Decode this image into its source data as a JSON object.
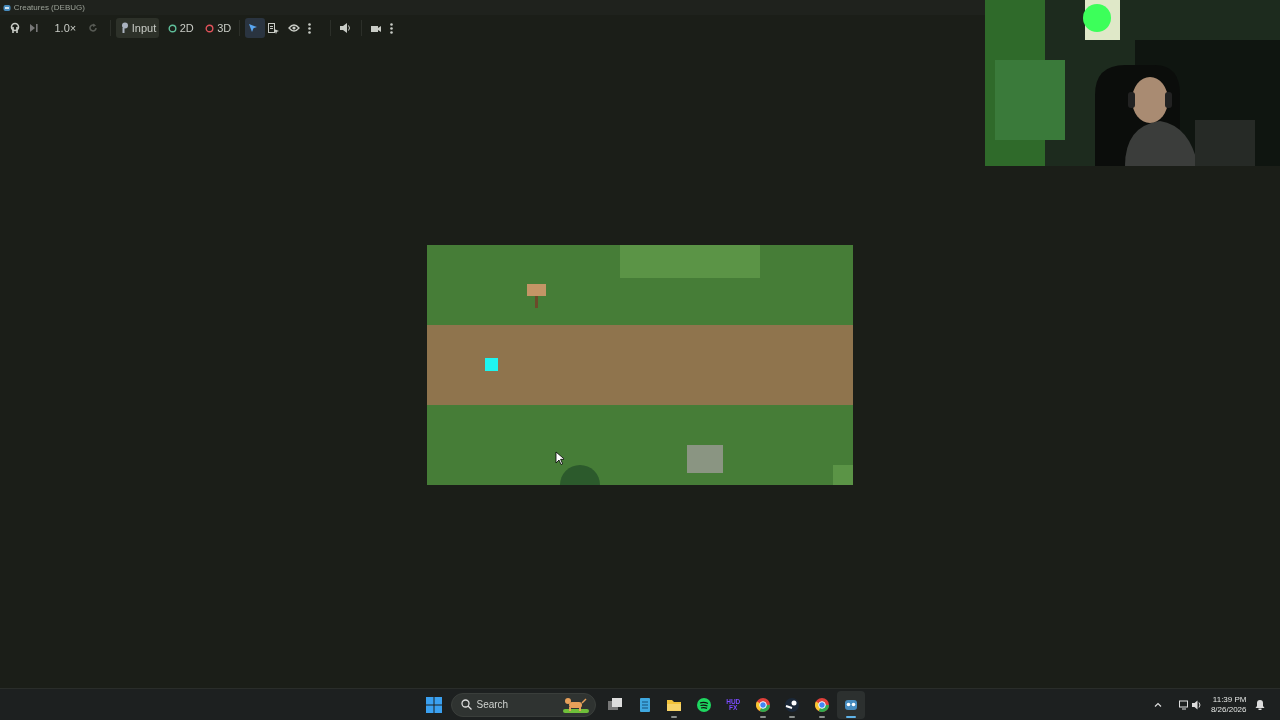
{
  "window": {
    "title": "Creatures (DEBUG)"
  },
  "toolbar": {
    "speed": "1.0×",
    "reset": {
      "disabled": true
    },
    "modes": [
      {
        "label": "Input",
        "selected": true
      },
      {
        "label": "2D",
        "selected": false
      },
      {
        "label": "3D",
        "selected": false
      }
    ],
    "tools": [
      {
        "selected": true
      },
      {
        "selected": false
      },
      {
        "selected": false
      }
    ]
  },
  "taskbar": {
    "search": {
      "placeholder": "Search"
    },
    "apps": [
      {
        "running": false,
        "active": false
      },
      {
        "running": false,
        "active": false
      },
      {
        "running": true,
        "active": false
      },
      {
        "running": false,
        "active": false
      },
      {
        "label": "HUD FX",
        "running": false,
        "active": false
      },
      {
        "running": true,
        "active": false
      },
      {
        "running": true,
        "active": false
      },
      {
        "running": true,
        "active": false
      },
      {
        "running": true,
        "active": true
      }
    ],
    "clock": {
      "time": "11:39 PM",
      "date": "8/26/2026"
    }
  }
}
